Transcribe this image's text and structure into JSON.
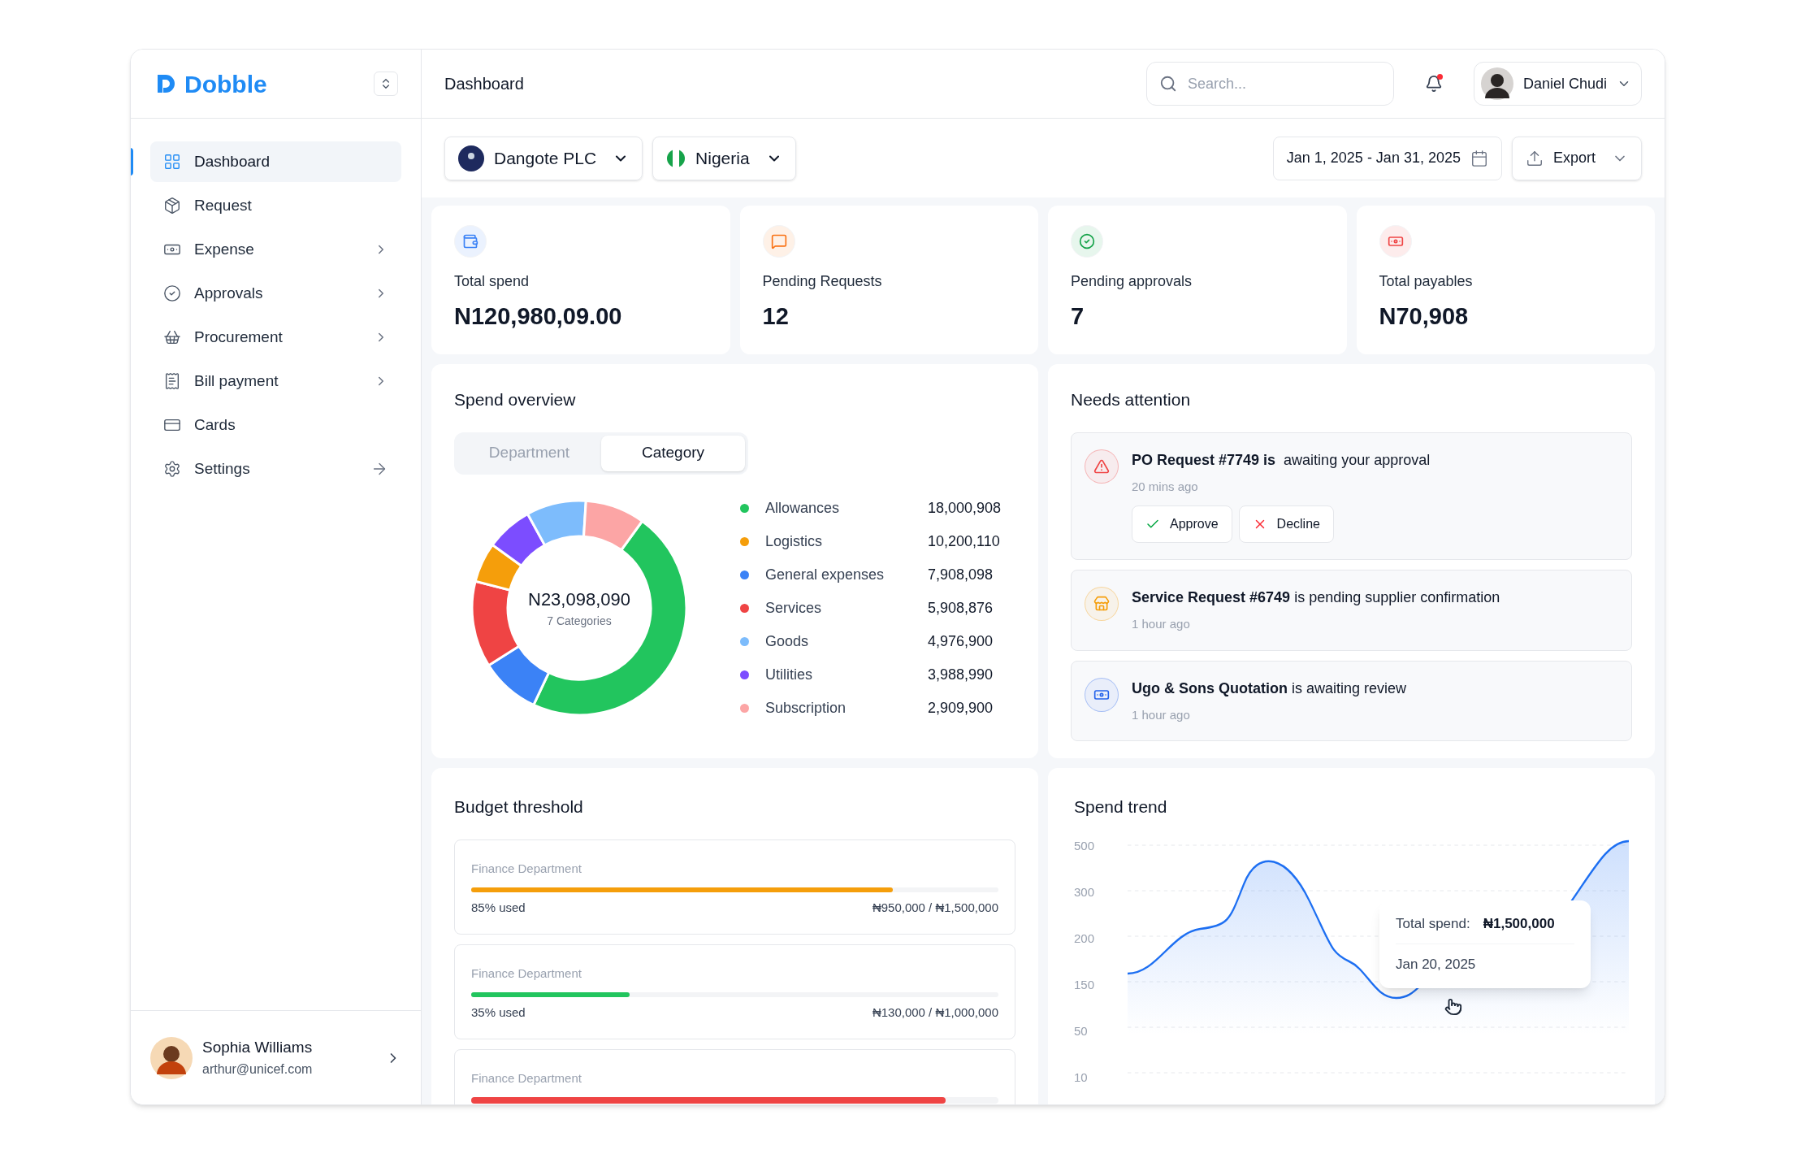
{
  "brand": {
    "name": "Dobble"
  },
  "sidebar": {
    "items": [
      {
        "label": "Dashboard",
        "kind": "link",
        "selected": true
      },
      {
        "label": "Request",
        "kind": "link",
        "selected": false
      },
      {
        "label": "Expense",
        "kind": "submenu",
        "selected": false
      },
      {
        "label": "Approvals",
        "kind": "submenu",
        "selected": false
      },
      {
        "label": "Procurement",
        "kind": "submenu",
        "selected": false
      },
      {
        "label": "Bill payment",
        "kind": "submenu",
        "selected": false
      },
      {
        "label": "Cards",
        "kind": "link",
        "selected": false
      },
      {
        "label": "Settings",
        "kind": "action",
        "selected": false
      }
    ],
    "user": {
      "name": "Sophia Williams",
      "email": "arthur@unicef.com"
    }
  },
  "header": {
    "title": "Dashboard",
    "search": {
      "placeholder": "Search..."
    },
    "notifications": {
      "unread": true
    },
    "user": {
      "name": "Daniel Chudi"
    }
  },
  "filters": {
    "company": "Dangote PLC",
    "country": "Nigeria",
    "date_range": "Jan 1, 2025 - Jan 31, 2025",
    "export": "Export"
  },
  "stats": [
    {
      "label": "Total spend",
      "value": "N120,980,09.00",
      "color": "#3b82f6"
    },
    {
      "label": "Pending Requests",
      "value": "12",
      "color": "#f97316"
    },
    {
      "label": "Pending approvals",
      "value": "7",
      "color": "#16a34a"
    },
    {
      "label": "Total payables",
      "value": "N70,908",
      "color": "#ef4444"
    }
  ],
  "spend_overview": {
    "title": "Spend overview",
    "tabs": [
      {
        "label": "Department",
        "selected": false
      },
      {
        "label": "Category",
        "selected": true
      }
    ],
    "total": "N23,098,090",
    "subtitle": "7 Categories",
    "chart_data": {
      "type": "donut",
      "categories": [
        "Allowances",
        "General expenses",
        "Services",
        "Logistics",
        "Utilities",
        "Goods",
        "Subscription"
      ],
      "values": [
        47,
        9,
        13,
        6,
        7,
        9,
        9
      ]
    },
    "legend": [
      {
        "value": "18,000,908",
        "color": "#22c55e"
      },
      {
        "value": "10,200,110",
        "color": "#f59e0b"
      },
      {
        "value": "7,908,098",
        "color": "#3b82f6"
      },
      {
        "value": "5,908,876",
        "color": "#ef4444"
      },
      {
        "value": "4,976,900",
        "color": "#7dbcfc"
      },
      {
        "value": "3,988,990",
        "color": "#7c4dff"
      },
      {
        "value": "2,909,900",
        "color": "#fca5a5"
      }
    ]
  },
  "needs_attention": {
    "title": "Needs attention",
    "items": [
      {
        "kind": "warning",
        "text": "**PO Request #7749 is**  awaiting your approval",
        "time": "20 mins ago",
        "actions": [
          {
            "kind": "approve",
            "label": "Approve"
          },
          {
            "kind": "decline",
            "label": "Decline"
          }
        ]
      },
      {
        "kind": "store",
        "text": "**Service Request #6749** is pending supplier confirmation",
        "time": "1 hour ago"
      },
      {
        "kind": "money",
        "text": "**Ugo & Sons Quotation** is awaiting review",
        "time": "1 hour ago"
      }
    ]
  },
  "budget_threshold": {
    "title": "Budget threshold",
    "items": [
      {
        "label": "Finance Department",
        "level": 0.8,
        "color": "#f59e0b",
        "used": "85% used",
        "amount": "₦950,000 / ₦1,500,000"
      },
      {
        "label": "Finance Department",
        "level": 0.3,
        "color": "#22c55e",
        "used": "35% used",
        "amount": "₦130,000 / ₦1,000,000"
      },
      {
        "label": "Finance Department",
        "level": 0.9,
        "color": "#ef4444"
      }
    ]
  },
  "spend_trend": {
    "title": "Spend trend",
    "y_labels": [
      "500",
      "300",
      "200",
      "150",
      "50",
      "10"
    ],
    "tooltip": {
      "label": "Total spend:",
      "value": "₦1,500,000",
      "date": "Jan 20, 2025"
    }
  }
}
